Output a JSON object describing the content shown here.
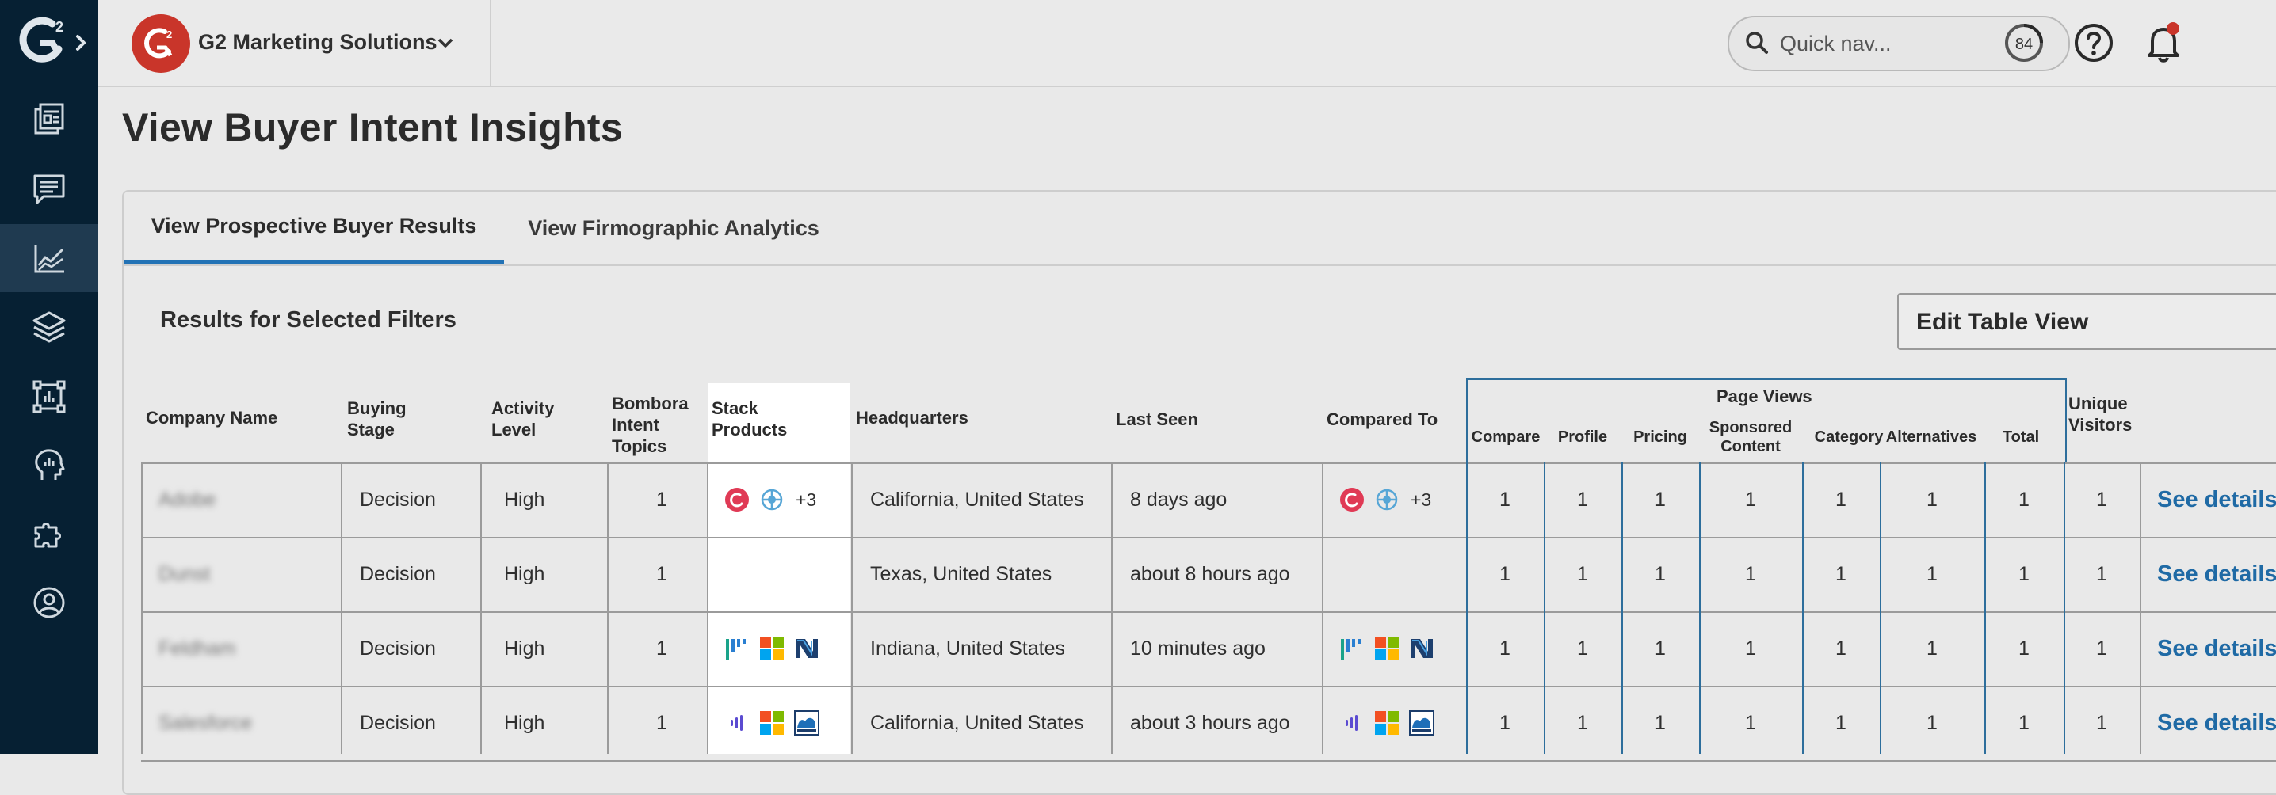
{
  "app": {
    "org_name": "G2 Marketing Solutions",
    "search_placeholder": "Quick nav...",
    "notifications_badge": "84"
  },
  "page": {
    "title": "View Buyer Intent Insights",
    "tabs": [
      {
        "label": "View Prospective Buyer Results",
        "active": true
      },
      {
        "label": "View Firmographic Analytics",
        "active": false
      }
    ],
    "results_title": "Results for Selected Filters",
    "edit_button": "Edit Table View"
  },
  "table": {
    "headers": {
      "company": "Company Name",
      "buying_stage": [
        "Buying",
        "Stage"
      ],
      "activity": [
        "Activity",
        "Level"
      ],
      "bombora": [
        "Bombora",
        "Intent",
        "Topics"
      ],
      "stack": [
        "Stack",
        "Products"
      ],
      "hq": "Headquarters",
      "last_seen": "Last Seen",
      "compared": "Compared To",
      "page_views": "Page Views",
      "pv_cols": [
        "Compare",
        "Profile",
        "Pricing",
        "Sponsored Content",
        "Category",
        "Alternatives",
        "Total"
      ],
      "unique": [
        "Unique",
        "Visitors"
      ]
    },
    "rows": [
      {
        "company": "Adobe",
        "stage": "Decision",
        "activity": "High",
        "bombora": "1",
        "stack_logos": [
          "g2-red-logo",
          "compass-logo"
        ],
        "stack_more": "+3",
        "hq": "California, United States",
        "last_seen": "8 days ago",
        "compared_logos": [
          "g2-red-logo",
          "compass-logo"
        ],
        "compared_more": "+3",
        "pv": [
          "1",
          "1",
          "1",
          "1",
          "1",
          "1",
          "1"
        ],
        "unique": "1",
        "link": "See details"
      },
      {
        "company": "Dunst",
        "stage": "Decision",
        "activity": "High",
        "bombora": "1",
        "stack_logos": [],
        "stack_more": "",
        "hq": "Texas, United States",
        "last_seen": "about 8 hours ago",
        "compared_logos": [],
        "compared_more": "",
        "pv": [
          "1",
          "1",
          "1",
          "1",
          "1",
          "1",
          "1"
        ],
        "unique": "1",
        "link": "See details"
      },
      {
        "company": "Feldham",
        "stage": "Decision",
        "activity": "High",
        "bombora": "1",
        "stack_logos": [
          "bars-logo",
          "microsoft-logo",
          "n-logo"
        ],
        "stack_more": "",
        "hq": "Indiana, United States",
        "last_seen": "10 minutes ago",
        "compared_logos": [
          "bars-logo",
          "microsoft-logo",
          "n-logo"
        ],
        "compared_more": "",
        "pv": [
          "1",
          "1",
          "1",
          "1",
          "1",
          "1",
          "1"
        ],
        "unique": "1",
        "link": "See details"
      },
      {
        "company": "Salesforce",
        "stage": "Decision",
        "activity": "High",
        "bombora": "1",
        "stack_logos": [
          "wave-logo",
          "microsoft-logo",
          "cloud-logo"
        ],
        "stack_more": "",
        "hq": "California, United States",
        "last_seen": "about 3 hours ago",
        "compared_logos": [
          "wave-logo",
          "microsoft-logo",
          "cloud-logo"
        ],
        "compared_more": "",
        "pv": [
          "1",
          "1",
          "1",
          "1",
          "1",
          "1",
          "1"
        ],
        "unique": "1",
        "link": "See details"
      }
    ]
  },
  "colors": {
    "rail": "#062033",
    "accent": "#2272b5",
    "link": "#1f6aa5",
    "brand_red": "#c9352a"
  }
}
